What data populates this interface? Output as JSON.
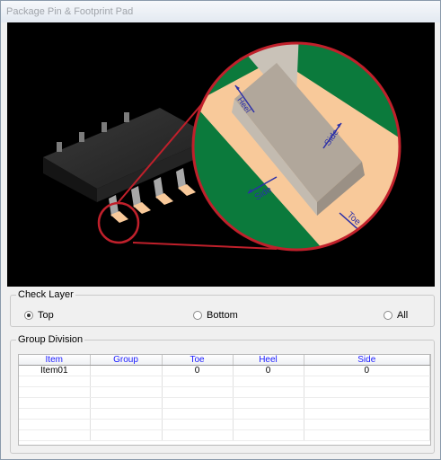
{
  "window": {
    "title": "Package Pin & Footprint Pad"
  },
  "preview": {
    "labels": {
      "heel": "Heel",
      "side_top": "Side",
      "side_left": "Side",
      "toe": "Toe"
    },
    "colors": {
      "background": "#000000",
      "board": "#0b7a3c",
      "pad": "#f8c99a",
      "pin": "#b1a79b",
      "lens": "#c0202b",
      "arrow": "#2b2fa8"
    }
  },
  "check_layer": {
    "title": "Check Layer",
    "options": [
      {
        "label": "Top",
        "selected": true
      },
      {
        "label": "Bottom",
        "selected": false
      },
      {
        "label": "All",
        "selected": false
      }
    ]
  },
  "group_division": {
    "title": "Group Division",
    "columns": [
      "Item",
      "Group",
      "Toe",
      "Heel",
      "Side"
    ],
    "rows": [
      {
        "item": "Item01",
        "group": "",
        "toe": "0",
        "heel": "0",
        "side": "0"
      }
    ]
  }
}
